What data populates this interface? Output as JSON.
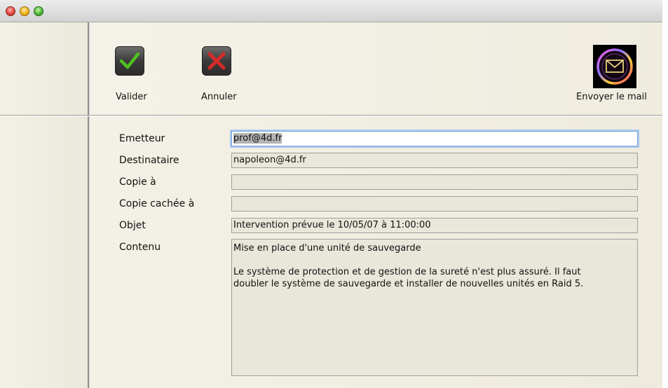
{
  "toolbar": {
    "validate_label": "Valider",
    "cancel_label": "Annuler",
    "send_label": "Envoyer le mail"
  },
  "form": {
    "sender": {
      "label": "Emetteur",
      "value": "prof@4d.fr"
    },
    "recipient": {
      "label": "Destinataire",
      "value": "napoleon@4d.fr"
    },
    "cc": {
      "label": "Copie à",
      "value": ""
    },
    "bcc": {
      "label": "Copie cachée à",
      "value": ""
    },
    "subject": {
      "label": "Objet",
      "value": "Intervention prévue le 10/05/07 à 11:00:00"
    },
    "body": {
      "label": "Contenu",
      "value": "Mise en place d'une unité de sauvegarde\n\nLe système de protection et de gestion de la sureté n'est plus assuré. Il faut\ndoubler le système de sauvegarde et installer de nouvelles unités en Raid 5."
    }
  },
  "colors": {
    "check_green": "#4fc21e",
    "cross_red": "#d42a2a",
    "background": "#f1efe3"
  }
}
